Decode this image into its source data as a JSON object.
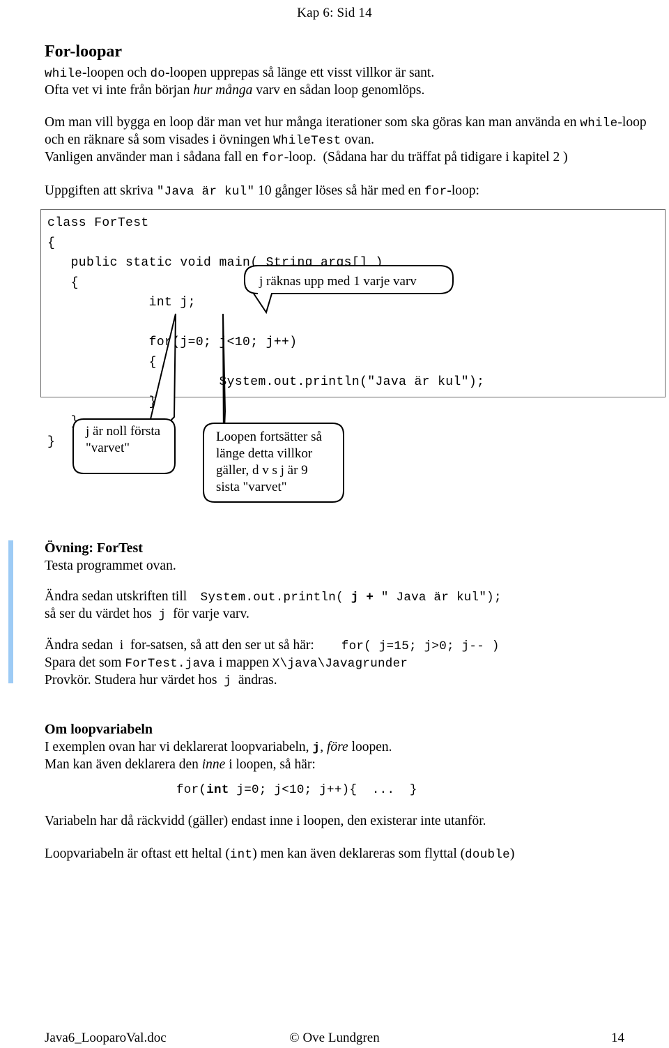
{
  "header": {
    "page_marker": "Kap 6:  Sid 14"
  },
  "title": "For-loopar",
  "intro": {
    "line1_a": "while",
    "line1_b": "-loopen och ",
    "line1_c": "do",
    "line1_d": "-loopen upprepas så länge ett visst villkor är sant.",
    "line2_a": "Ofta vet vi inte från början ",
    "line2_italic": "hur många",
    "line2_b": " varv en sådan loop genomlöps."
  },
  "body": {
    "p1_a": "Om man vill bygga en loop där man vet hur många iterationer som ska göras kan man använda en ",
    "p1_code": "while",
    "p1_b": "-loop",
    "p2_a": "och en räknare så som visades i övningen ",
    "p2_code": "WhileTest",
    "p2_b": " ovan.",
    "p3_a": "Vanligen använder man i sådana fall en ",
    "p3_code": "for",
    "p3_b": "-loop.  (Sådana har du träffat på tidigare i kapitel 2 )",
    "p4_a": "Uppgiften att skriva ",
    "p4_code": "\"Java är kul\"",
    "p4_b": " 10 gånger löses så här med en ",
    "p4_code2": "for",
    "p4_c": "-loop:"
  },
  "code_block": {
    "text": "class ForTest\n{\n   public static void main( String args[] )\n   {\n             int j;\n\n             for(j=0; j<10; j++)\n             {\n                      System.out.println(\"Java är kul\");\n             }\n   }\n}"
  },
  "callouts": [
    {
      "id": "callout-increment",
      "text": "j  räknas upp med 1 varje varv"
    },
    {
      "id": "callout-init",
      "text": "j är noll första\n\"varvet\""
    },
    {
      "id": "callout-condition",
      "text": "Loopen fortsätter så\nlänge detta villkor\ngäller, d v s  j är 9\nsista \"varvet\""
    }
  ],
  "exercise": {
    "heading": "Övning: ForTest",
    "line1": "Testa programmet ovan.",
    "line2_a": "Ändra sedan utskriften till    ",
    "line2_code_a": "System.out.println( ",
    "line2_code_bold": "j +",
    "line2_code_b": " \" Java är kul\");",
    "line3_a": "så ser du värdet hos  ",
    "line3_code": "j",
    "line3_b": "  för varje varv.",
    "line4_a": "Ändra sedan  i  for-satsen, så att den ser ut så här:        ",
    "line4_code": "for( j=15; j>0; j-- )",
    "line5_a": "Spara det som ",
    "line5_code": "ForTest.java",
    "line5_b": " i mappen ",
    "line5_code2": "X\\java\\Javagrunder",
    "line6_a": "Provkör. Studera hur värdet hos  ",
    "line6_code": "j",
    "line6_b": "  ändras."
  },
  "loopvar": {
    "heading": "Om loopvariabeln",
    "line1_a": "I exemplen ovan har vi deklarerat loopvariabeln, ",
    "line1_code": "j",
    "line1_b": ", ",
    "line1_italic": "före",
    "line1_c": " loopen.",
    "line2_a": "Man kan även deklarera den ",
    "line2_italic": "inne",
    "line2_b": " i loopen, så här:",
    "code_a": "for(",
    "code_bold": "int",
    "code_b": " j=0; j<10; j++){  ...  }",
    "line3": "Variabeln har då räckvidd (gäller) endast inne i loopen, den existerar inte utanför.",
    "line4_a": "Loopvariabeln är oftast ett heltal (",
    "line4_code": "int",
    "line4_b": ") men kan även deklareras som flyttal (",
    "line4_code2": "double",
    "line4_c": ")"
  },
  "footer": {
    "left": "Java6_LooparoVal.doc",
    "center": "© Ove Lundgren",
    "right": "14"
  },
  "colors": {
    "margin_bar": "#9dcbf5",
    "code_border": "#6b6b6b",
    "text": "#000000"
  }
}
